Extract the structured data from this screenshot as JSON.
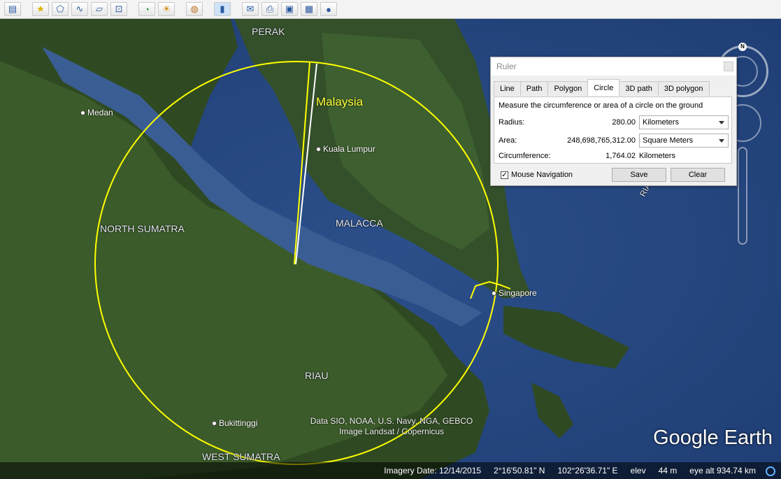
{
  "toolbar": {
    "buttons": [
      "sidebar",
      "placemark",
      "polygon",
      "path",
      "image-overlay",
      "record-tour",
      "historical-imagery",
      "sunlight",
      "planets",
      "ruler",
      "email",
      "print",
      "save-image",
      "view-in-maps",
      "google-earth"
    ]
  },
  "map": {
    "labels": {
      "perak": "PERAK",
      "north_sumatra": "NORTH SUMATRA",
      "malacca": "MALACCA",
      "riau": "RIAU",
      "riau_islands": "RIAU IS",
      "west_sumatra": "WEST SUMATRA",
      "malaysia": "Malaysia"
    },
    "cities": {
      "medan": "Medan",
      "kuala_lumpur": "Kuala Lumpur",
      "singapore": "Singapore",
      "bukittinggi": "Bukittinggi"
    },
    "attribution_line1": "Data SIO, NOAA, U.S. Navy, NGA, GEBCO",
    "attribution_line2": "Image Landsat / Copernicus",
    "logo": "Google Earth",
    "compass_north": "N"
  },
  "status": {
    "imagery_date": "Imagery Date: 12/14/2015",
    "lat": "2°16'50.81\" N",
    "lon": "102°26'36.71\" E",
    "elev_label": "elev",
    "elev_value": "44 m",
    "eye_alt": "eye alt 934.74 km"
  },
  "ruler": {
    "title": "Ruler",
    "tabs": [
      "Line",
      "Path",
      "Polygon",
      "Circle",
      "3D path",
      "3D polygon"
    ],
    "active_tab": "Circle",
    "description": "Measure the circumference or area of a circle on the ground",
    "radius_label": "Radius:",
    "radius_value": "280.00",
    "radius_unit": "Kilometers",
    "area_label": "Area:",
    "area_value": "248,698,765,312.00",
    "area_unit": "Square Meters",
    "circumference_label": "Circumference:",
    "circumference_value": "1,764.02",
    "circumference_unit": "Kilometers",
    "mouse_navigation": "Mouse Navigation",
    "mouse_navigation_checked": "✓",
    "save": "Save",
    "clear": "Clear"
  }
}
